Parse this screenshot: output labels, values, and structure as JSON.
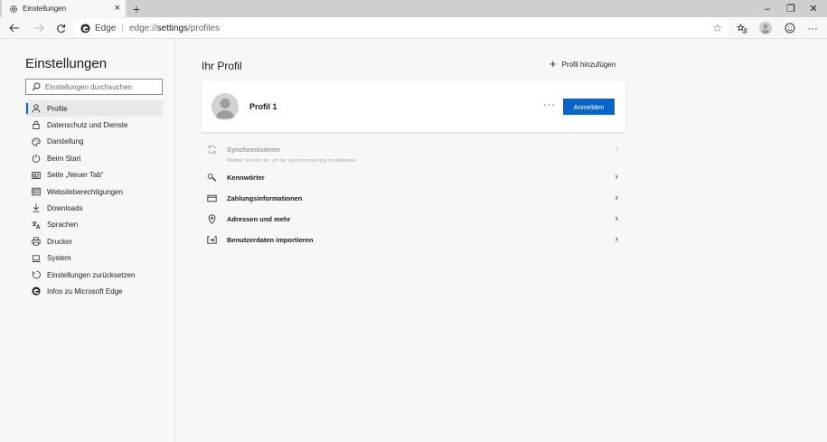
{
  "tab": {
    "title": "Einstellungen",
    "close": "×",
    "new_tab": "+"
  },
  "window_controls": {
    "minimize": "–",
    "restore": "❐",
    "close": "✕"
  },
  "address_bar": {
    "site_label": "Edge",
    "separator": "|",
    "url_prefix": "edge://",
    "url_bold": "settings",
    "url_suffix": "/profiles"
  },
  "sidebar": {
    "title": "Einstellungen",
    "search_placeholder": "Einstellungen durchsuchen",
    "items": [
      {
        "label": "Profile",
        "icon": "person-icon",
        "active": true
      },
      {
        "label": "Datenschutz und Dienste",
        "icon": "lock-icon"
      },
      {
        "label": "Darstellung",
        "icon": "palette-icon"
      },
      {
        "label": "Beim Start",
        "icon": "power-icon"
      },
      {
        "label": "Seite „Neuer Tab“",
        "icon": "new-tab-page-icon"
      },
      {
        "label": "Websiteberechtigungen",
        "icon": "site-permissions-icon"
      },
      {
        "label": "Downloads",
        "icon": "download-icon"
      },
      {
        "label": "Sprachen",
        "icon": "language-icon"
      },
      {
        "label": "Drucker",
        "icon": "printer-icon"
      },
      {
        "label": "System",
        "icon": "laptop-icon"
      },
      {
        "label": "Einstellungen zurücksetzen",
        "icon": "reset-icon"
      },
      {
        "label": "Infos zu Microsoft Edge",
        "icon": "edge-logo-icon"
      }
    ]
  },
  "main": {
    "title": "Ihr Profil",
    "add_profile": "Profil hinzufügen",
    "profile_card": {
      "name": "Profil 1",
      "more": "···",
      "signin": "Anmelden"
    },
    "rows": {
      "sync_label": "Synchronisieren",
      "sync_sub": "Melden Sie sich an, um die Synchronisierung zu aktivieren.",
      "passwords": "Kennwörter",
      "payment": "Zahlungsinformationen",
      "addresses": "Adressen und mehr",
      "import": "Benutzerdaten importieren"
    },
    "chevron": "›"
  },
  "colors": {
    "accent": "#0a64c8",
    "tabstrip": "#cfcfcf",
    "background": "#f7f7f7"
  }
}
